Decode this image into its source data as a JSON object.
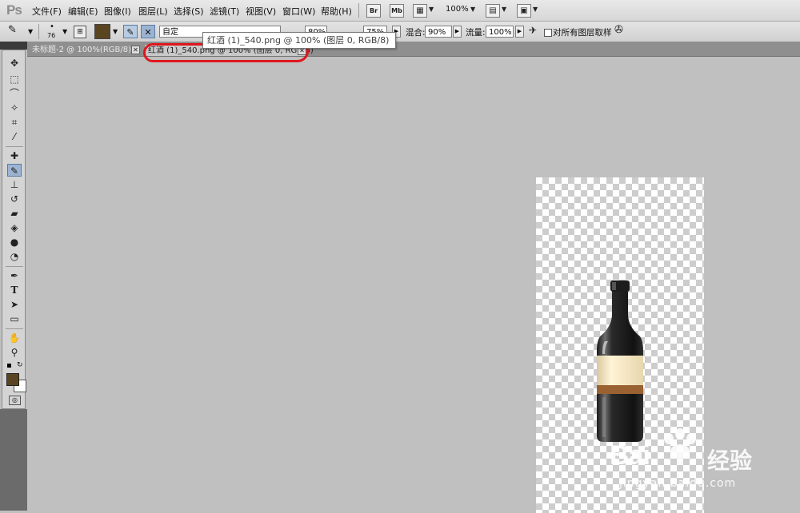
{
  "app": {
    "logo": "Ps"
  },
  "menu": {
    "items": [
      "文件(F)",
      "编辑(E)",
      "图像(I)",
      "图层(L)",
      "选择(S)",
      "滤镜(T)",
      "视图(V)",
      "窗口(W)",
      "帮助(H)"
    ]
  },
  "menubar_extras": {
    "bridge": "Br",
    "mini_bridge": "Mb",
    "zoom": "100%"
  },
  "options": {
    "brush_size": "76",
    "mode_value": "自定",
    "exposure_value": "80%",
    "range_value": "75%",
    "blend_label": "混合:",
    "blend_value": "90%",
    "flow_label": "流量:",
    "flow_value": "100%",
    "sample_all_label": "对所有图层取样",
    "foreground_color": "#5a4521"
  },
  "tooltip": {
    "text": "红酒 (1)_540.png @ 100% (图层 0, RGB/8)"
  },
  "tabs": [
    {
      "label": "未标题-2 @ 100%(RGB/8) *"
    },
    {
      "label": "红酒 (1)_540.png @ 100% (图层 0, RGB/8)"
    }
  ],
  "watermark": {
    "brand_latin": "Bai",
    "brand_cn": "经验",
    "url": "jingyan.baidu.com"
  },
  "colors": {
    "highlight": "#e0161d",
    "selected_tool": "#9cb4d2"
  }
}
